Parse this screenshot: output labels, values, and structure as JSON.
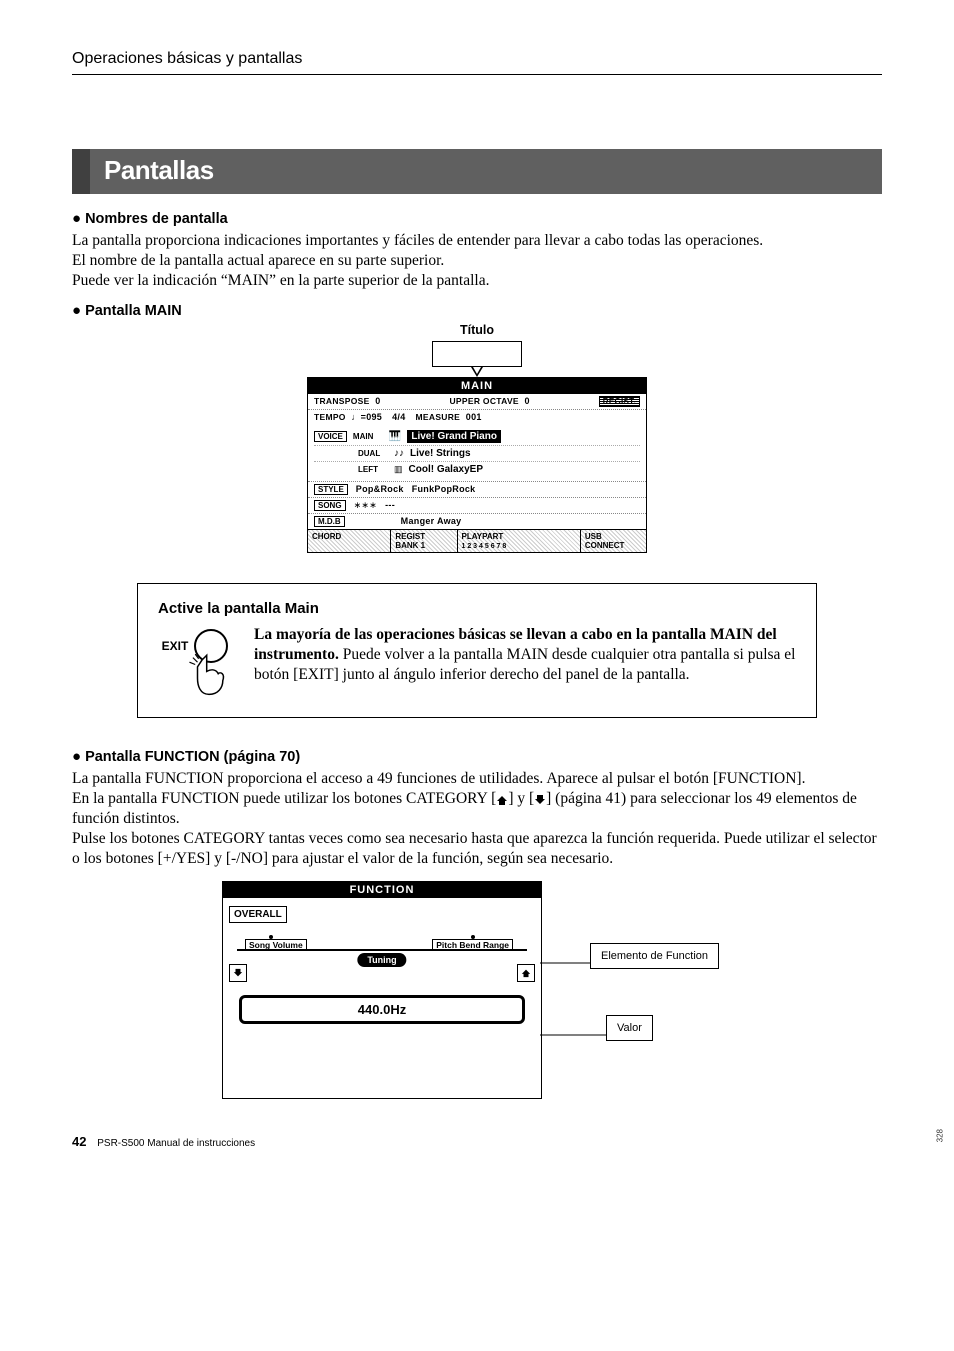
{
  "header": {
    "title": "Operaciones básicas y pantallas"
  },
  "section_bar": "Pantallas",
  "nombres": {
    "heading": "Nombres de pantalla",
    "p1": "La pantalla proporciona indicaciones importantes y fáciles de entender para llevar a cabo todas las operaciones.",
    "p2": "El nombre de la pantalla actual aparece en su parte superior.",
    "p3": "Puede ver la indicación “MAIN” en la parte superior de la pantalla."
  },
  "pantalla_main": {
    "heading": "Pantalla MAIN",
    "titulo_label": "Título",
    "lcd": {
      "title": "MAIN",
      "transpose_label": "TRANSPOSE",
      "transpose_value": "0",
      "upper_octave_label": "UPPER OCTAVE",
      "upper_octave_value": "0",
      "regist_badge": "REGIST.",
      "tempo_label": "TEMPO",
      "tempo_note": "♩=095",
      "time_sig": "4/4",
      "measure_label": "MEASURE",
      "measure_value": "001",
      "voice_badge": "VOICE",
      "voices": {
        "main_tag": "MAIN",
        "main_name": "Live! Grand Piano",
        "dual_tag": "DUAL",
        "dual_name": "Live! Strings",
        "left_tag": "LEFT",
        "left_name": "Cool! GalaxyEP"
      },
      "style_badge": "STYLE",
      "style_cat": "Pop&Rock",
      "style_name": "FunkPopRock",
      "song_badge": "SONG",
      "song_name": "---",
      "mdb_badge": "M.D.B",
      "mdb_name": "Manger Away",
      "bottom": {
        "chord": "CHORD",
        "regist": "REGIST",
        "bank": "BANK 1",
        "playpart": "PLAYPART",
        "nums": "1 2 3 4 5 6 7 8",
        "usb": "USB",
        "connect": "CONNECT"
      }
    }
  },
  "callout": {
    "title": "Active la pantalla Main",
    "exit_label": "EXIT",
    "bold": "La mayoría de las operaciones básicas se llevan a cabo en la pantalla MAIN del instrumento.",
    "rest": "Puede volver a la pantalla MAIN desde cualquier otra pantalla si pulsa el botón [EXIT] junto al ángulo inferior derecho del panel de la pantalla."
  },
  "function": {
    "heading": "Pantalla FUNCTION (página 70)",
    "p1": "La pantalla FUNCTION proporciona el acceso a 49 funciones de utilidades. Aparece al pulsar el botón [FUNCTION].",
    "p2a": "En la pantalla FUNCTION puede utilizar los botones CATEGORY [",
    "p2b": "] y [",
    "p2c": "] (página 41) para seleccionar los 49 elementos de función distintos.",
    "p3": "Pulse los botones CATEGORY tantas veces como sea necesario hasta que aparezca la función requerida. Puede utilizar el selector o los botones [+/YES] y [-/NO] para ajustar el valor de la función, según sea necesario.",
    "lcd": {
      "title": "FUNCTION",
      "overall": "OVERALL",
      "items": {
        "left": "Song Volume",
        "right": "Pitch Bend Range",
        "selected": "Tuning"
      },
      "value": "440.0Hz"
    },
    "callouts": {
      "element": "Elemento de Function",
      "value": "Valor"
    }
  },
  "footer": {
    "page": "42",
    "doc": "PSR-S500  Manual de instrucciones"
  },
  "side_num": "328"
}
